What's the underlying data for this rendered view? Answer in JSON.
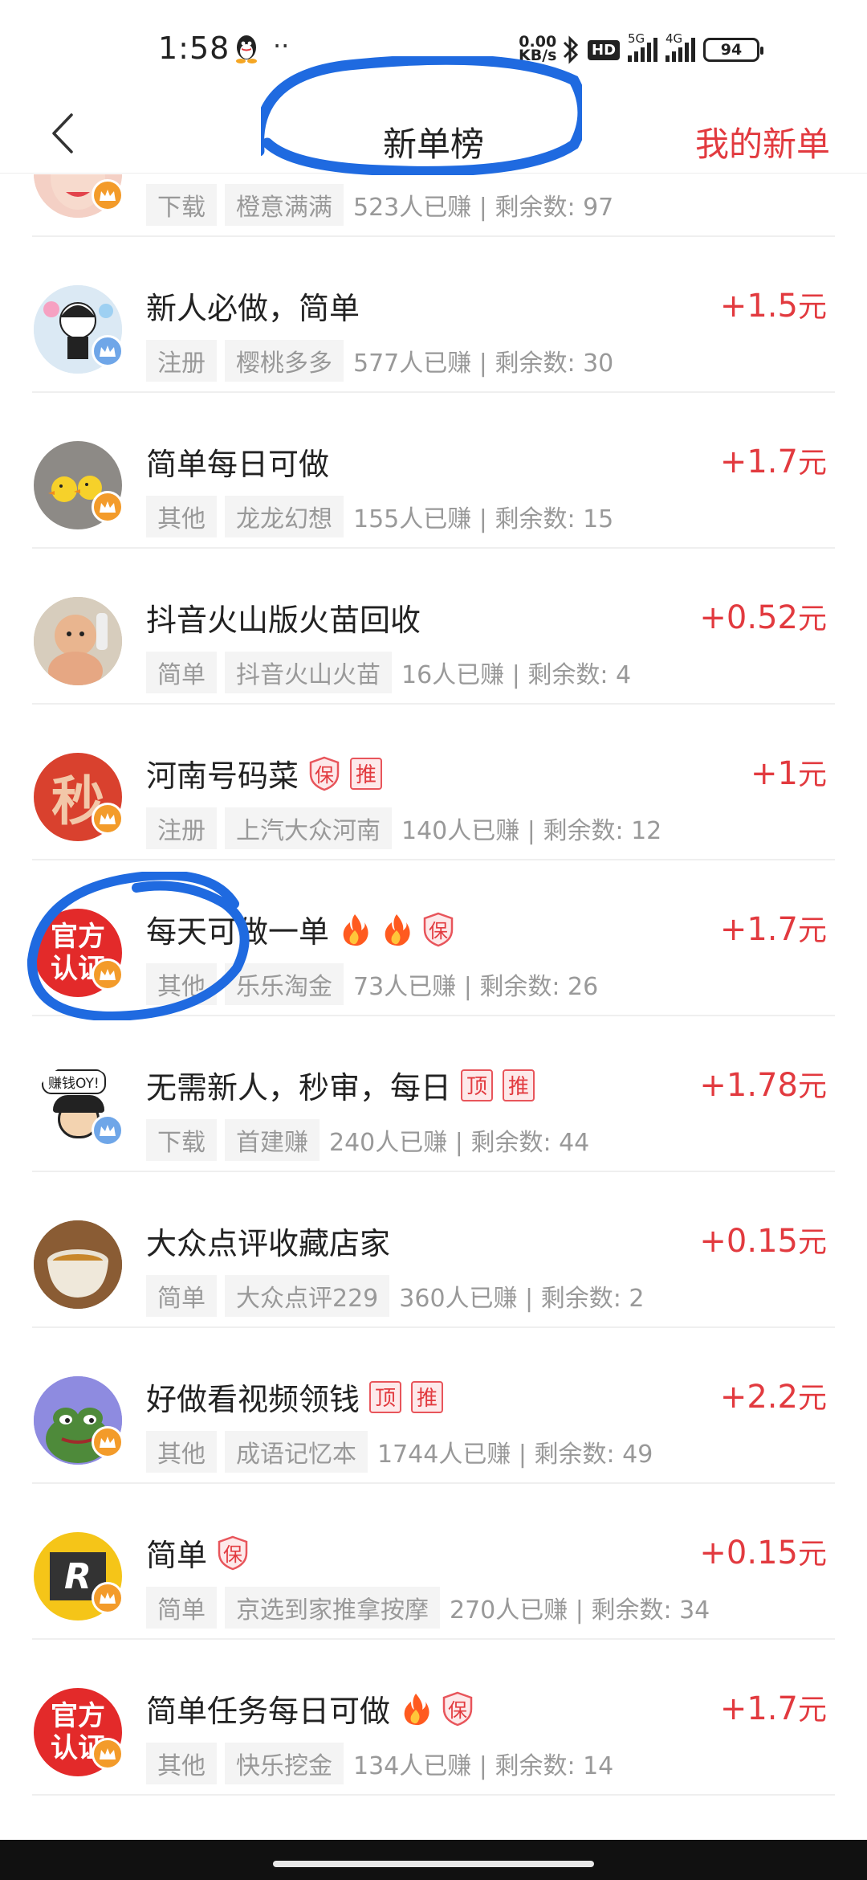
{
  "status_bar": {
    "time": "1:58",
    "more": "··",
    "net_speed_value": "0.00",
    "net_speed_unit": "KB/s",
    "hd": "HD",
    "signal_1": "5G",
    "signal_2": "4G",
    "battery": "94"
  },
  "nav": {
    "back_icon": "chevron-left-icon",
    "title": "新单榜",
    "right_link": "我的新单"
  },
  "colors": {
    "accent": "#e23a3f",
    "annotation": "#1f6ae0"
  },
  "tasks": [
    {
      "title": "",
      "reward": "",
      "unit": "",
      "category": "下载",
      "publisher": "橙意满满",
      "stats": "523人已赚 | 剩余数: 97",
      "tags": []
    },
    {
      "title": "新人必做，简单",
      "reward": "+1.5",
      "unit": "元",
      "category": "注册",
      "publisher": "樱桃多多",
      "stats": "577人已赚 | 剩余数: 30",
      "tags": []
    },
    {
      "title": "简单每日可做",
      "reward": "+1.7",
      "unit": "元",
      "category": "其他",
      "publisher": "龙龙幻想",
      "stats": "155人已赚 | 剩余数: 15",
      "tags": []
    },
    {
      "title": "抖音火山版火苗回收",
      "reward": "+0.52",
      "unit": "元",
      "category": "简单",
      "publisher": "抖音火山火苗",
      "stats": "16人已赚 | 剩余数: 4",
      "tags": []
    },
    {
      "title": "河南号码菜",
      "reward": "+1",
      "unit": "元",
      "category": "注册",
      "publisher": "上汽大众河南",
      "stats": "140人已赚 | 剩余数: 12",
      "tags": [
        "保",
        "推"
      ]
    },
    {
      "title": "每天可做一单",
      "reward": "+1.7",
      "unit": "元",
      "category": "其他",
      "publisher": "乐乐淘金",
      "stats": "73人已赚 | 剩余数: 26",
      "tags": [
        "fire",
        "fire",
        "保"
      ]
    },
    {
      "title": "无需新人，秒审，每日",
      "reward": "+1.78",
      "unit": "元",
      "category": "下载",
      "publisher": "首建赚",
      "stats": "240人已赚 | 剩余数: 44",
      "tags": [
        "顶",
        "推"
      ]
    },
    {
      "title": "大众点评收藏店家",
      "reward": "+0.15",
      "unit": "元",
      "category": "简单",
      "publisher": "大众点评229",
      "stats": "360人已赚 | 剩余数: 2",
      "tags": []
    },
    {
      "title": "好做看视频领钱",
      "reward": "+2.2",
      "unit": "元",
      "category": "其他",
      "publisher": "成语记忆本",
      "stats": "1744人已赚 | 剩余数: 49",
      "tags": [
        "顶",
        "推"
      ]
    },
    {
      "title": "简单",
      "reward": "+0.15",
      "unit": "元",
      "category": "简单",
      "publisher": "京选到家推拿按摩",
      "stats": "270人已赚 | 剩余数: 34",
      "tags": [
        "保"
      ]
    },
    {
      "title": "简单任务每日可做",
      "reward": "+1.7",
      "unit": "元",
      "category": "其他",
      "publisher": "快乐挖金",
      "stats": "134人已赚 | 剩余数: 14",
      "tags": [
        "fire",
        "保"
      ]
    }
  ],
  "avatars": {
    "seal_char": "秒",
    "official_line1": "官方",
    "official_line2": "认证",
    "r_logo": "R",
    "bubble_text": "赚钱OY!"
  }
}
